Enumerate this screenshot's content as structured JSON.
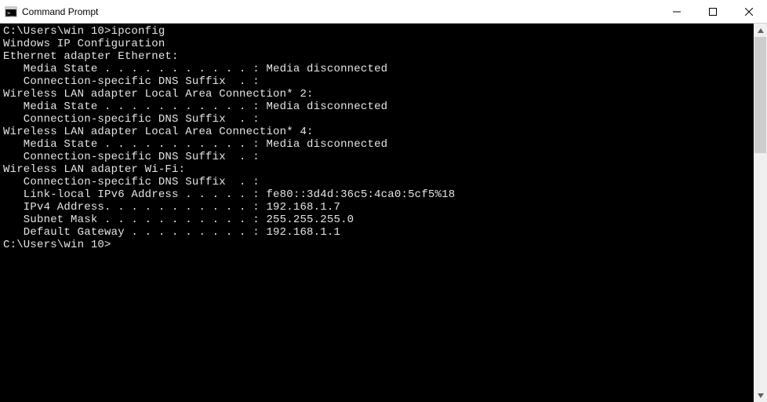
{
  "titlebar": {
    "title": "Command Prompt"
  },
  "terminal": {
    "prompt1": "C:\\Users\\win 10>",
    "command1": "ipconfig",
    "blank": "",
    "heading": "Windows IP Configuration",
    "adapters": [
      {
        "header": "Ethernet adapter Ethernet:",
        "lines": [
          "   Media State . . . . . . . . . . . : Media disconnected",
          "   Connection-specific DNS Suffix  . :"
        ]
      },
      {
        "header": "Wireless LAN adapter Local Area Connection* 2:",
        "lines": [
          "   Media State . . . . . . . . . . . : Media disconnected",
          "   Connection-specific DNS Suffix  . :"
        ]
      },
      {
        "header": "Wireless LAN adapter Local Area Connection* 4:",
        "lines": [
          "   Media State . . . . . . . . . . . : Media disconnected",
          "   Connection-specific DNS Suffix  . :"
        ]
      },
      {
        "header": "Wireless LAN adapter Wi-Fi:",
        "lines": [
          "   Connection-specific DNS Suffix  . :",
          "   Link-local IPv6 Address . . . . . : fe80::3d4d:36c5:4ca0:5cf5%18",
          "   IPv4 Address. . . . . . . . . . . : 192.168.1.7",
          "   Subnet Mask . . . . . . . . . . . : 255.255.255.0",
          "   Default Gateway . . . . . . . . . : 192.168.1.1"
        ]
      }
    ],
    "prompt2": "C:\\Users\\win 10>"
  }
}
